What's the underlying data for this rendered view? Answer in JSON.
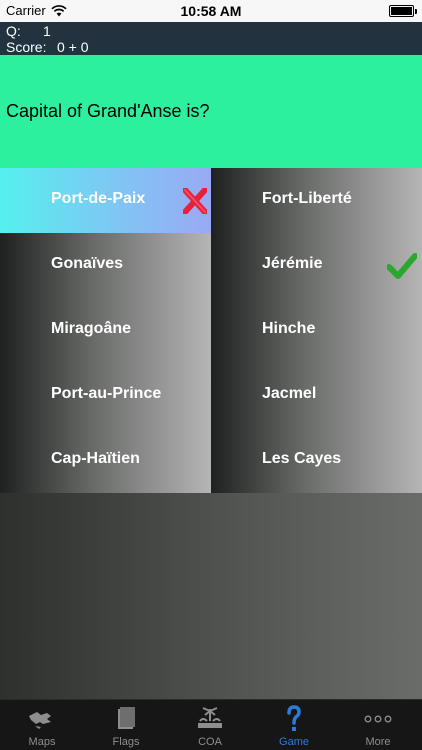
{
  "status_bar": {
    "carrier": "Carrier",
    "time": "10:58 AM"
  },
  "score": {
    "q_label": "Q:",
    "q_value": "1",
    "score_label": "Score:",
    "score_value": "0 + 0"
  },
  "question": {
    "text": "Capital of Grand'Anse is?"
  },
  "answers": [
    {
      "label": "Port-de-Paix",
      "state": "wrong-selected"
    },
    {
      "label": "Fort-Liberté",
      "state": "none"
    },
    {
      "label": "Gonaïves",
      "state": "none"
    },
    {
      "label": "Jérémie",
      "state": "correct"
    },
    {
      "label": "Miragoâne",
      "state": "none"
    },
    {
      "label": "Hinche",
      "state": "none"
    },
    {
      "label": "Port-au-Prince",
      "state": "none"
    },
    {
      "label": "Jacmel",
      "state": "none"
    },
    {
      "label": "Cap-Haïtien",
      "state": "none"
    },
    {
      "label": "Les Cayes",
      "state": "none"
    }
  ],
  "colors": {
    "question_bg": "#2cf09d",
    "score_bg": "#23323f",
    "selected_answer": "#7fc6f3",
    "wrong_mark": "#e8213a",
    "correct_mark": "#2aa82e",
    "tab_active": "#2b7cd8"
  },
  "tabs": [
    {
      "label": "Maps",
      "icon": "map-icon",
      "active": false
    },
    {
      "label": "Flags",
      "icon": "flag-icon",
      "active": false
    },
    {
      "label": "COA",
      "icon": "coat-of-arms-icon",
      "active": false
    },
    {
      "label": "Game",
      "icon": "question-mark-icon",
      "active": true
    },
    {
      "label": "More",
      "icon": "more-dots-icon",
      "active": false
    }
  ]
}
